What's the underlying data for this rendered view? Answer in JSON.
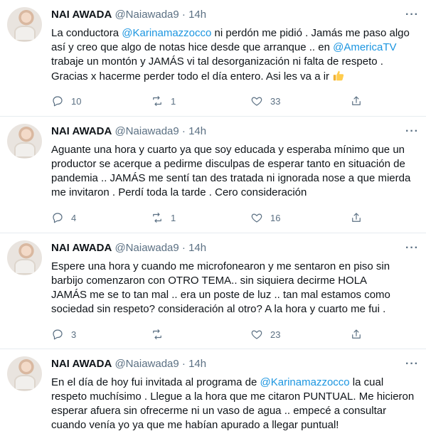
{
  "tweets": [
    {
      "name": "NAI AWADA",
      "handle": "@Naiawada9",
      "sep": "·",
      "time": "14h",
      "lines": [
        [
          "La conductora ",
          {
            "link": "@Karinamazzocco"
          },
          " ni perdón me pidió . Jamás me paso algo"
        ],
        [
          "así y creo que algo de notas hice desde que arranque .. en ",
          {
            "link": "@AmericaTV"
          }
        ],
        [
          "trabaje un montón y JAMÁS vi tal desorganización ni falta de respeto ."
        ],
        [
          "Gracias x hacerme perder todo el día entero. Asi les va a ir ",
          {
            "emoji": "thumbs-up-icon"
          }
        ]
      ],
      "replies": "10",
      "retweets": "1",
      "likes": "33"
    },
    {
      "name": "NAI AWADA",
      "handle": "@Naiawada9",
      "sep": "·",
      "time": "14h",
      "lines": [
        [
          "Aguante una hora y cuarto ya que soy educada y  esperaba mínimo que un"
        ],
        [
          "productor se acerque a pedirme disculpas de esperar tanto en situación de"
        ],
        [
          "pandemia .. JAMÁS me sentí tan des tratada ni ignorada nose a que mierda"
        ],
        [
          "me invitaron . Perdí toda la tarde . Cero consideración"
        ]
      ],
      "replies": "4",
      "retweets": "1",
      "likes": "16"
    },
    {
      "name": "NAI AWADA",
      "handle": "@Naiawada9",
      "sep": "·",
      "time": "14h",
      "lines": [
        [
          "Espere una hora y cuando me microfonearon y me sentaron en piso sin"
        ],
        [
          "barbijo comenzaron con OTRO TEMA.. sin siquiera decirme HOLA"
        ],
        [
          "JAMÁS me se to tan mal .. era un poste de luz .. tan mal estamos como"
        ],
        [
          "sociedad sin respeto? consideración al otro? A la hora y cuarto me fui ."
        ]
      ],
      "replies": "3",
      "retweets": "",
      "likes": "23"
    },
    {
      "name": "NAI AWADA",
      "handle": "@Naiawada9",
      "sep": "·",
      "time": "14h",
      "lines": [
        [
          "En el día de hoy fui invitada al programa de ",
          {
            "link": "@Karinamazzocco"
          },
          " la cual"
        ],
        [
          "respeto muchísimo . Llegue a la hora que me citaron PUNTUAL. Me hicieron"
        ],
        [
          "esperar afuera sin ofrecerme ni un vaso de agua .. empecé a consultar"
        ],
        [
          "cuando venía yo ya que me habían apurado a llegar puntual!"
        ]
      ]
    }
  ],
  "more_label": "···",
  "colors": {
    "link": "#1b95e0",
    "meta": "#5b7083",
    "divider": "#e6ecf0"
  }
}
